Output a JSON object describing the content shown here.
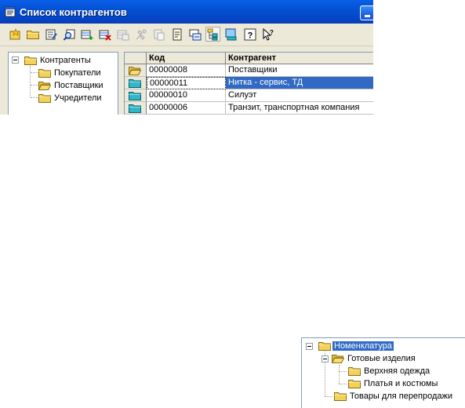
{
  "window": {
    "title": "Список контрагентов"
  },
  "toolbar": {
    "buttons": [
      "new-item-icon",
      "new-folder-icon",
      "edit-icon",
      "find-icon",
      "add-row-icon",
      "delete-icon",
      "copy-icon",
      "properties-icon",
      "paste-icon",
      "document-icon",
      "move-icon",
      "hierarchy-icon",
      "report-icon",
      "help-icon",
      "context-help-icon"
    ]
  },
  "tree": {
    "root": "Контрагенты",
    "children": [
      "Покупатели",
      "Поставщики",
      "Учредители"
    ]
  },
  "grid": {
    "columns": [
      "Код",
      "Контрагент"
    ],
    "rows": [
      {
        "code": "00000008",
        "name": "Поставщики"
      },
      {
        "code": "00000011",
        "name": "Нитка - сервис, ТД"
      },
      {
        "code": "00000010",
        "name": "Силуэт"
      },
      {
        "code": "00000006",
        "name": "Транзит, транспортная компания"
      }
    ],
    "selected_row": 1
  },
  "nomenclature": {
    "root": "Номенклатура",
    "group": "Готовые изделия",
    "group_children": [
      "Верхняя одежда",
      "Платья и костюмы"
    ],
    "other": "Товары для перепродажи"
  },
  "colors": {
    "title_bar": "#0554d4",
    "selection": "#316ac5",
    "folder": "#f5d35e",
    "window_bg": "#ece9d8"
  }
}
